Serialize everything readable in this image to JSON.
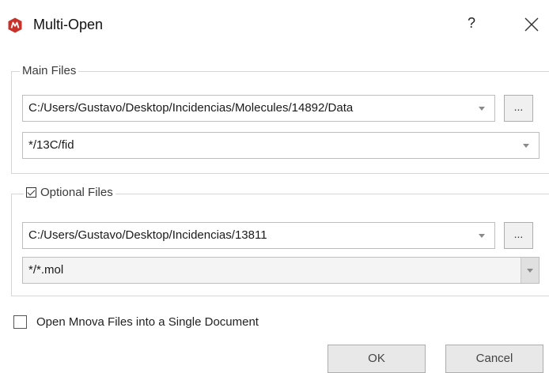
{
  "window": {
    "title": "Multi-Open",
    "help_label": "?",
    "close_icon": "close-icon",
    "app_icon": "mnova-logo-icon",
    "accent": "#c8322b"
  },
  "main_files": {
    "legend": "Main Files",
    "path": "C:/Users/Gustavo/Desktop/Incidencias/Molecules/14892/Data",
    "filter": "*/13C/fid",
    "browse_label": "..."
  },
  "optional_files": {
    "legend": "Optional Files",
    "checked": true,
    "path": "C:/Users/Gustavo/Desktop/Incidencias/13811",
    "filter": "*/*.mol",
    "browse_label": "..."
  },
  "single_document": {
    "label": "Open Mnova Files into a Single Document",
    "checked": false
  },
  "buttons": {
    "ok": "OK",
    "cancel": "Cancel"
  }
}
